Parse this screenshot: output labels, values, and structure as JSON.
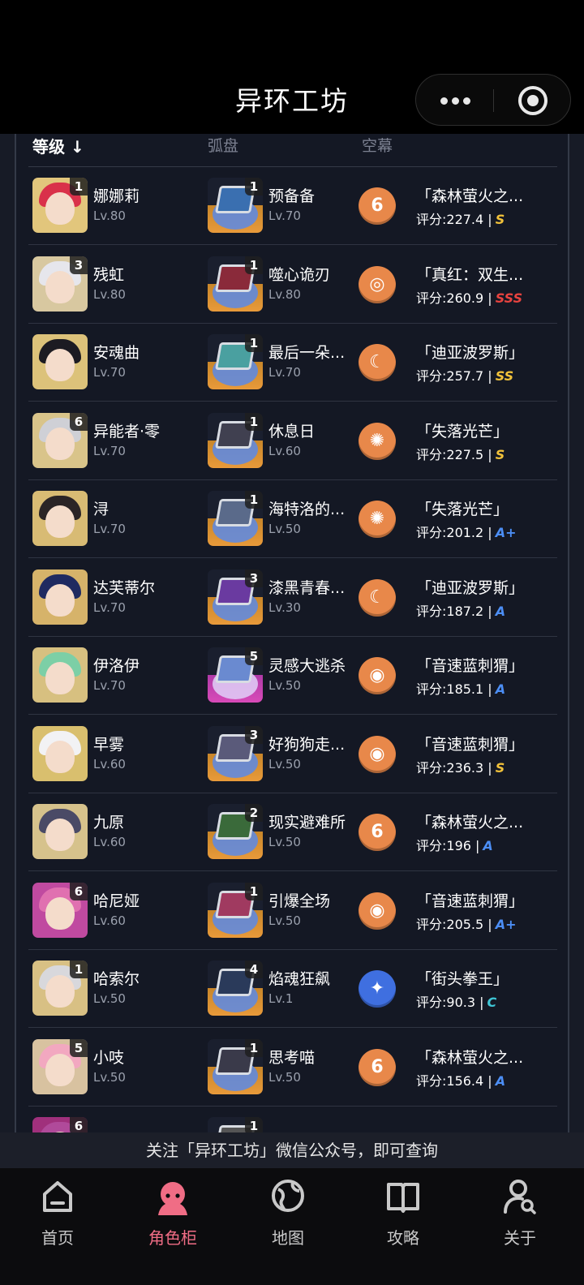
{
  "app": {
    "title": "异环工坊"
  },
  "table": {
    "headers": {
      "level": "等级 ↓",
      "disc": "弧盘",
      "drive": "空幕"
    },
    "rows": [
      {
        "char": "娜娜莉",
        "char_level": "Lv.80",
        "badge": "1",
        "disc": "预备备",
        "disc_level": "Lv.70",
        "disc_badge": "1",
        "drive_icon": "flame-drive-icon",
        "set": "「森林萤火之...",
        "score": "评分:227.4 |",
        "grade": "S"
      },
      {
        "char": "残虹",
        "char_level": "Lv.80",
        "badge": "3",
        "disc": "噬心诡刃",
        "disc_level": "Lv.80",
        "disc_badge": "1",
        "drive_icon": "spiral-drive-icon",
        "set": "「真红：双生...",
        "score": "评分:260.9 |",
        "grade": "SSS"
      },
      {
        "char": "安魂曲",
        "char_level": "Lv.70",
        "badge": "",
        "disc": "最后一朵...",
        "disc_level": "Lv.70",
        "disc_badge": "1",
        "drive_icon": "moon-drive-icon",
        "set": "「迪亚波罗斯」",
        "score": "评分:257.7 |",
        "grade": "SS"
      },
      {
        "char": "异能者·零",
        "char_level": "Lv.70",
        "badge": "6",
        "disc": "休息日",
        "disc_level": "Lv.60",
        "disc_badge": "1",
        "drive_icon": "sun-drive-icon",
        "set": "「失落光芒」",
        "score": "评分:227.5 |",
        "grade": "S"
      },
      {
        "char": "浔",
        "char_level": "Lv.70",
        "badge": "",
        "disc": "海特洛的...",
        "disc_level": "Lv.50",
        "disc_badge": "1",
        "drive_icon": "sun-drive-icon",
        "set": "「失落光芒」",
        "score": "评分:201.2 |",
        "grade": "A+"
      },
      {
        "char": "达芙蒂尔",
        "char_level": "Lv.70",
        "badge": "",
        "disc": "漆黑青春...",
        "disc_level": "Lv.30",
        "disc_badge": "3",
        "drive_icon": "moon-drive-icon",
        "set": "「迪亚波罗斯」",
        "score": "评分:187.2 |",
        "grade": "A"
      },
      {
        "char": "伊洛伊",
        "char_level": "Lv.70",
        "badge": "",
        "disc": "灵感大逃杀",
        "disc_level": "Lv.50",
        "disc_badge": "5",
        "drive_icon": "ring-drive-icon",
        "set": "「音速蓝刺猬」",
        "score": "评分:185.1 |",
        "grade": "A"
      },
      {
        "char": "早雾",
        "char_level": "Lv.60",
        "badge": "",
        "disc": "好狗狗走...",
        "disc_level": "Lv.50",
        "disc_badge": "3",
        "drive_icon": "ring-drive-icon",
        "set": "「音速蓝刺猬」",
        "score": "评分:236.3 |",
        "grade": "S"
      },
      {
        "char": "九原",
        "char_level": "Lv.60",
        "badge": "",
        "disc": "现实避难所",
        "disc_level": "Lv.50",
        "disc_badge": "2",
        "drive_icon": "flame-drive-icon",
        "set": "「森林萤火之...",
        "score": "评分:196 |",
        "grade": "A"
      },
      {
        "char": "哈尼娅",
        "char_level": "Lv.60",
        "badge": "6",
        "disc": "引爆全场",
        "disc_level": "Lv.50",
        "disc_badge": "1",
        "drive_icon": "ring-drive-icon",
        "set": "「音速蓝刺猬」",
        "score": "评分:205.5 |",
        "grade": "A+"
      },
      {
        "char": "哈索尔",
        "char_level": "Lv.50",
        "badge": "1",
        "disc": "焰魂狂飙",
        "disc_level": "Lv.1",
        "disc_badge": "4",
        "drive_icon": "shuriken-drive-icon",
        "set": "「街头拳王」",
        "score": "评分:90.3 |",
        "grade": "C"
      },
      {
        "char": "小吱",
        "char_level": "Lv.50",
        "badge": "5",
        "disc": "思考喵",
        "disc_level": "Lv.50",
        "disc_badge": "1",
        "drive_icon": "flame-drive-icon",
        "set": "「森林萤火之...",
        "score": "评分:156.4 |",
        "grade": "A"
      },
      {
        "char": "",
        "char_level": "",
        "badge": "6",
        "disc": "",
        "disc_level": "",
        "disc_badge": "1",
        "drive_icon": "",
        "set": "",
        "score": "",
        "grade": ""
      }
    ]
  },
  "grade_colors": {
    "SSS": "#e8433f",
    "SS": "#f2c23a",
    "S": "#f2c23a",
    "A+": "#4c8ef5",
    "A": "#4c8ef5",
    "C": "#3fc6d6"
  },
  "notice": "关注「异环工坊」微信公众号，即可查询",
  "tabs": [
    {
      "label": "首页",
      "icon": "home-icon",
      "active": false
    },
    {
      "label": "角色柜",
      "icon": "character-icon",
      "active": true
    },
    {
      "label": "地图",
      "icon": "globe-icon",
      "active": false
    },
    {
      "label": "攻略",
      "icon": "book-icon",
      "active": false
    },
    {
      "label": "关于",
      "icon": "user-search-icon",
      "active": false
    }
  ]
}
